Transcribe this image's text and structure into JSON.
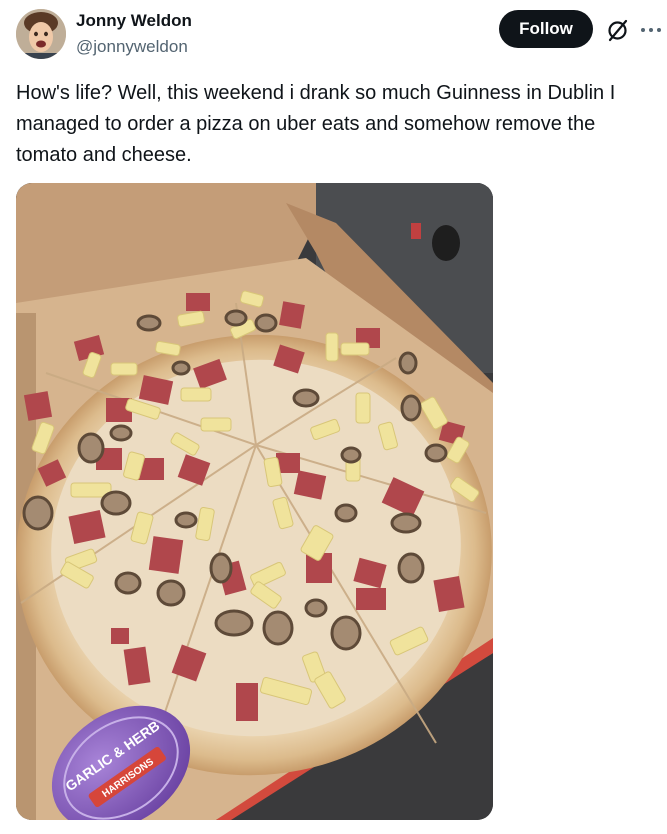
{
  "author": {
    "name": "Jonny Weldon",
    "handle": "@jonnyweldon"
  },
  "actions": {
    "follow_label": "Follow"
  },
  "icons": {
    "grok": "grok-icon",
    "more": "more-options-icon"
  },
  "tweet": {
    "text": "How's life? Well, this weekend i drank so much Guinness in Dublin I managed to order a pizza on uber eats and somehow remove the tomato and cheese."
  },
  "media": {
    "sauce_pot_label_1": "GARLIC & HERB",
    "sauce_pot_label_2": "HARRISONS"
  },
  "colors": {
    "follow_bg": "#0f1419",
    "handle": "#536471",
    "box": "#c9a27c",
    "crust": "#e6cda6",
    "ham": "#b04a4f",
    "pineapple": "#efe39a",
    "mushroom": "#8d7662",
    "sauce_pot": "#8a5fc2"
  }
}
